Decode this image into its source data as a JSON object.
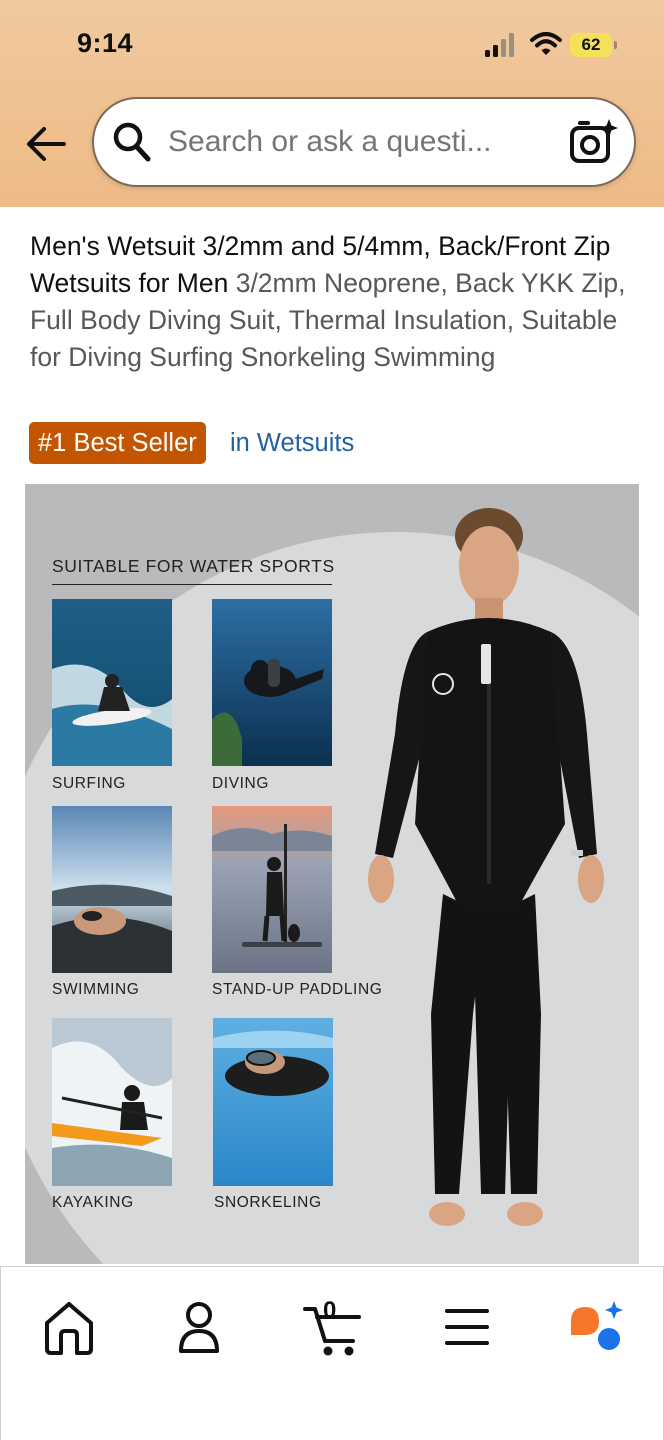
{
  "status_bar": {
    "time": "9:14",
    "battery": "62"
  },
  "search": {
    "placeholder": "Search or ask a questi..."
  },
  "product": {
    "title": "Men's Wetsuit 3/2mm and 5/4mm, Back/Front Zip Wetsuits for Men",
    "subtitle": "3/2mm Neoprene, Back YKK Zip, Full Body Diving Suit, Thermal Insulation, Suitable for Diving Surfing Snorkeling Swimming",
    "badge": "#1 Best Seller",
    "category": "in Wetsuits"
  },
  "product_image": {
    "heading": "SUITABLE FOR WATER SPORTS",
    "sports": [
      "SURFING",
      "DIVING",
      "SWIMMING",
      "STAND-UP PADDLING",
      "KAYAKING",
      "SNORKELING"
    ]
  },
  "nav": {
    "cart_count": "0"
  },
  "colors": {
    "header_bg": "#efc08f",
    "badge_bg": "#c45500",
    "link": "#2162a1",
    "ai_orange": "#f7772a",
    "ai_blue": "#1a73e8"
  }
}
